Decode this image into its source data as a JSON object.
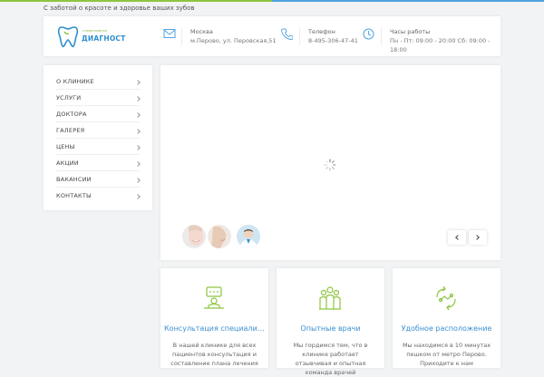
{
  "tagline": "С заботой о красоте и здоровье ваших зубов",
  "logo": {
    "small": "стоматология",
    "big": "ДИАГНОСТ"
  },
  "header": {
    "address": {
      "title": "Москва",
      "value": "м.Перово, ул. Перовская,51",
      "icon": "mail-icon"
    },
    "phone": {
      "title": "Телефон",
      "value": "8-495-306-47-41",
      "icon": "phone-icon"
    },
    "hours": {
      "title": "Часы работы",
      "value": "Пн - Пт: 09:00 - 20:00 Сб: 09:00 - 18:00",
      "icon": "clock-icon"
    }
  },
  "sidebar": {
    "items": [
      {
        "label": "О КЛИНИКЕ"
      },
      {
        "label": "УСЛУГИ"
      },
      {
        "label": "ДОКТОРА"
      },
      {
        "label": "ГАЛЕРЕЯ"
      },
      {
        "label": "ЦЕНЫ"
      },
      {
        "label": "АКЦИИ"
      },
      {
        "label": "ВАКАНСИИ"
      },
      {
        "label": "КОНТАКТЫ"
      }
    ]
  },
  "cards": [
    {
      "title": "Консультация специалиста",
      "text": "В нашей клинике для всех пациентов консультация и составление плана лечения",
      "icon": "consultation-icon"
    },
    {
      "title": "Опытные врачи",
      "text": "Мы гордимся тем, что в клинике работает отзывчивая и опытная команда врачей",
      "icon": "doctors-icon"
    },
    {
      "title": "Удобное расположение",
      "text": "Мы находимся в 10 минутах пешком от метро Перово. Приходите к нам",
      "icon": "location-icon"
    }
  ],
  "colors": {
    "green": "#8cc63f",
    "blue": "#3a8fcf",
    "background": "#f1f3f5"
  }
}
